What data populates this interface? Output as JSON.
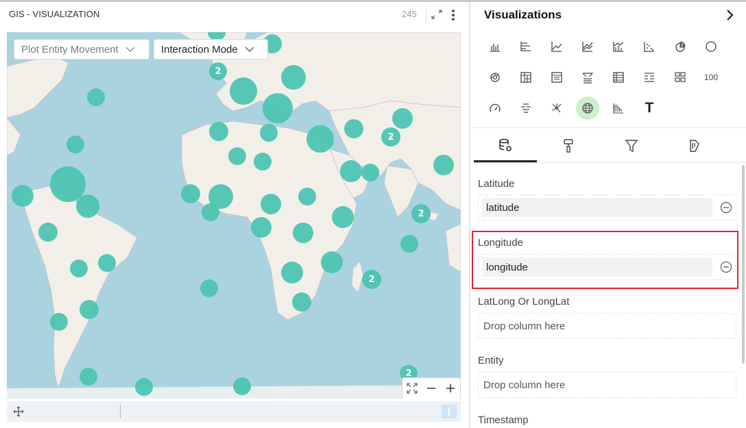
{
  "panel": {
    "title": "GIS - VISUALIZATION",
    "count": "245"
  },
  "map": {
    "plot_dropdown": "Plot Entity Movement",
    "interaction_dropdown": "Interaction Mode",
    "cluster_labels": [
      "2",
      "2",
      "2",
      "2",
      "2",
      "2",
      "2"
    ]
  },
  "visualizations": {
    "title": "Visualizations",
    "icons": [
      "column-chart-icon",
      "bar-chart-icon",
      "line-chart-icon",
      "area-chart-icon",
      "combo-chart-icon",
      "scatter-chart-icon",
      "pie-chart-icon",
      "donut-chart-icon",
      "sunburst-icon",
      "pivot-table-icon",
      "table-icon",
      "filter-table-icon",
      "list-table-icon",
      "detail-list-icon",
      "grid-icon",
      "kpi-number-icon",
      "gauge-icon",
      "word-cloud-icon",
      "network-graph-icon",
      "geo-map-icon",
      "histogram-icon",
      "text-icon"
    ],
    "kpi_label": "100",
    "text_label": "T",
    "tabs": [
      "data-tab",
      "format-tab",
      "filter-tab",
      "analytics-tab"
    ]
  },
  "fields": {
    "latitude_label": "Latitude",
    "latitude_value": "latitude",
    "longitude_label": "Longitude",
    "longitude_value": "longitude",
    "latlong_label": "LatLong Or LongLat",
    "latlong_placeholder": "Drop column here",
    "entity_label": "Entity",
    "entity_placeholder": "Drop column here",
    "timestamp_label": "Timestamp"
  },
  "colors": {
    "cluster": "#4dc4b2",
    "ocean": "#aad3df",
    "land": "#f2efe9",
    "highlight": "#e2202a",
    "active_viz": "#cdeecb"
  }
}
